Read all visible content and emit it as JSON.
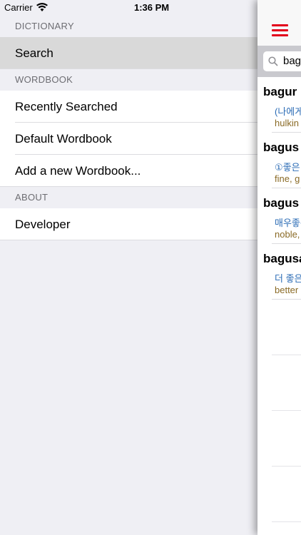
{
  "status": {
    "carrier": "Carrier",
    "time": "1:36 PM"
  },
  "menu": {
    "sections": {
      "dictionary": "DICTIONARY",
      "wordbook": "WORDBOOK",
      "about": "ABOUT"
    },
    "items": {
      "search": "Search",
      "recently_searched": "Recently Searched",
      "default_wordbook": "Default Wordbook",
      "add_wordbook": "Add a new Wordbook...",
      "developer": "Developer"
    }
  },
  "search": {
    "query": "bag"
  },
  "results": [
    {
      "word": "bagur",
      "korean": "(나에게",
      "english": "hulkin"
    },
    {
      "word": "bagus",
      "korean": "①좋은",
      "english": "fine, g"
    },
    {
      "word": "bagus",
      "korean": "매우좋은",
      "english": "noble,"
    },
    {
      "word": "bagusa",
      "korean": "더 좋은",
      "english": "better"
    }
  ],
  "colors": {
    "accent": "#e3001b",
    "korean_text": "#2a6bb5",
    "english_text": "#8a6a25"
  }
}
